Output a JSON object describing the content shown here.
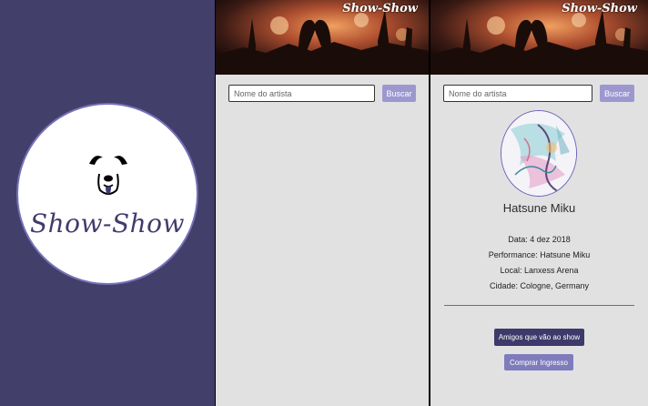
{
  "splash": {
    "logo_text": "Show-Show"
  },
  "header": {
    "brand": "Show-Show"
  },
  "search": {
    "placeholder": "Nome do artista",
    "button_label": "Buscar"
  },
  "artist": {
    "name": "Hatsune Miku",
    "info": [
      "Data: 4 dez 2018",
      "Performance: Hatsune Miku",
      "Local: Lanxess Arena",
      "Cidade: Cologne, Germany"
    ],
    "friends_button": "Amigos que vão ao show",
    "buy_button": "Comprar Ingresso"
  },
  "colors": {
    "splash_bg": "#423f6a",
    "accent": "#9c98cf",
    "dark_button": "#3d3a6b",
    "light_button": "#7f7cbc",
    "panel_bg": "#e1e1e1"
  }
}
